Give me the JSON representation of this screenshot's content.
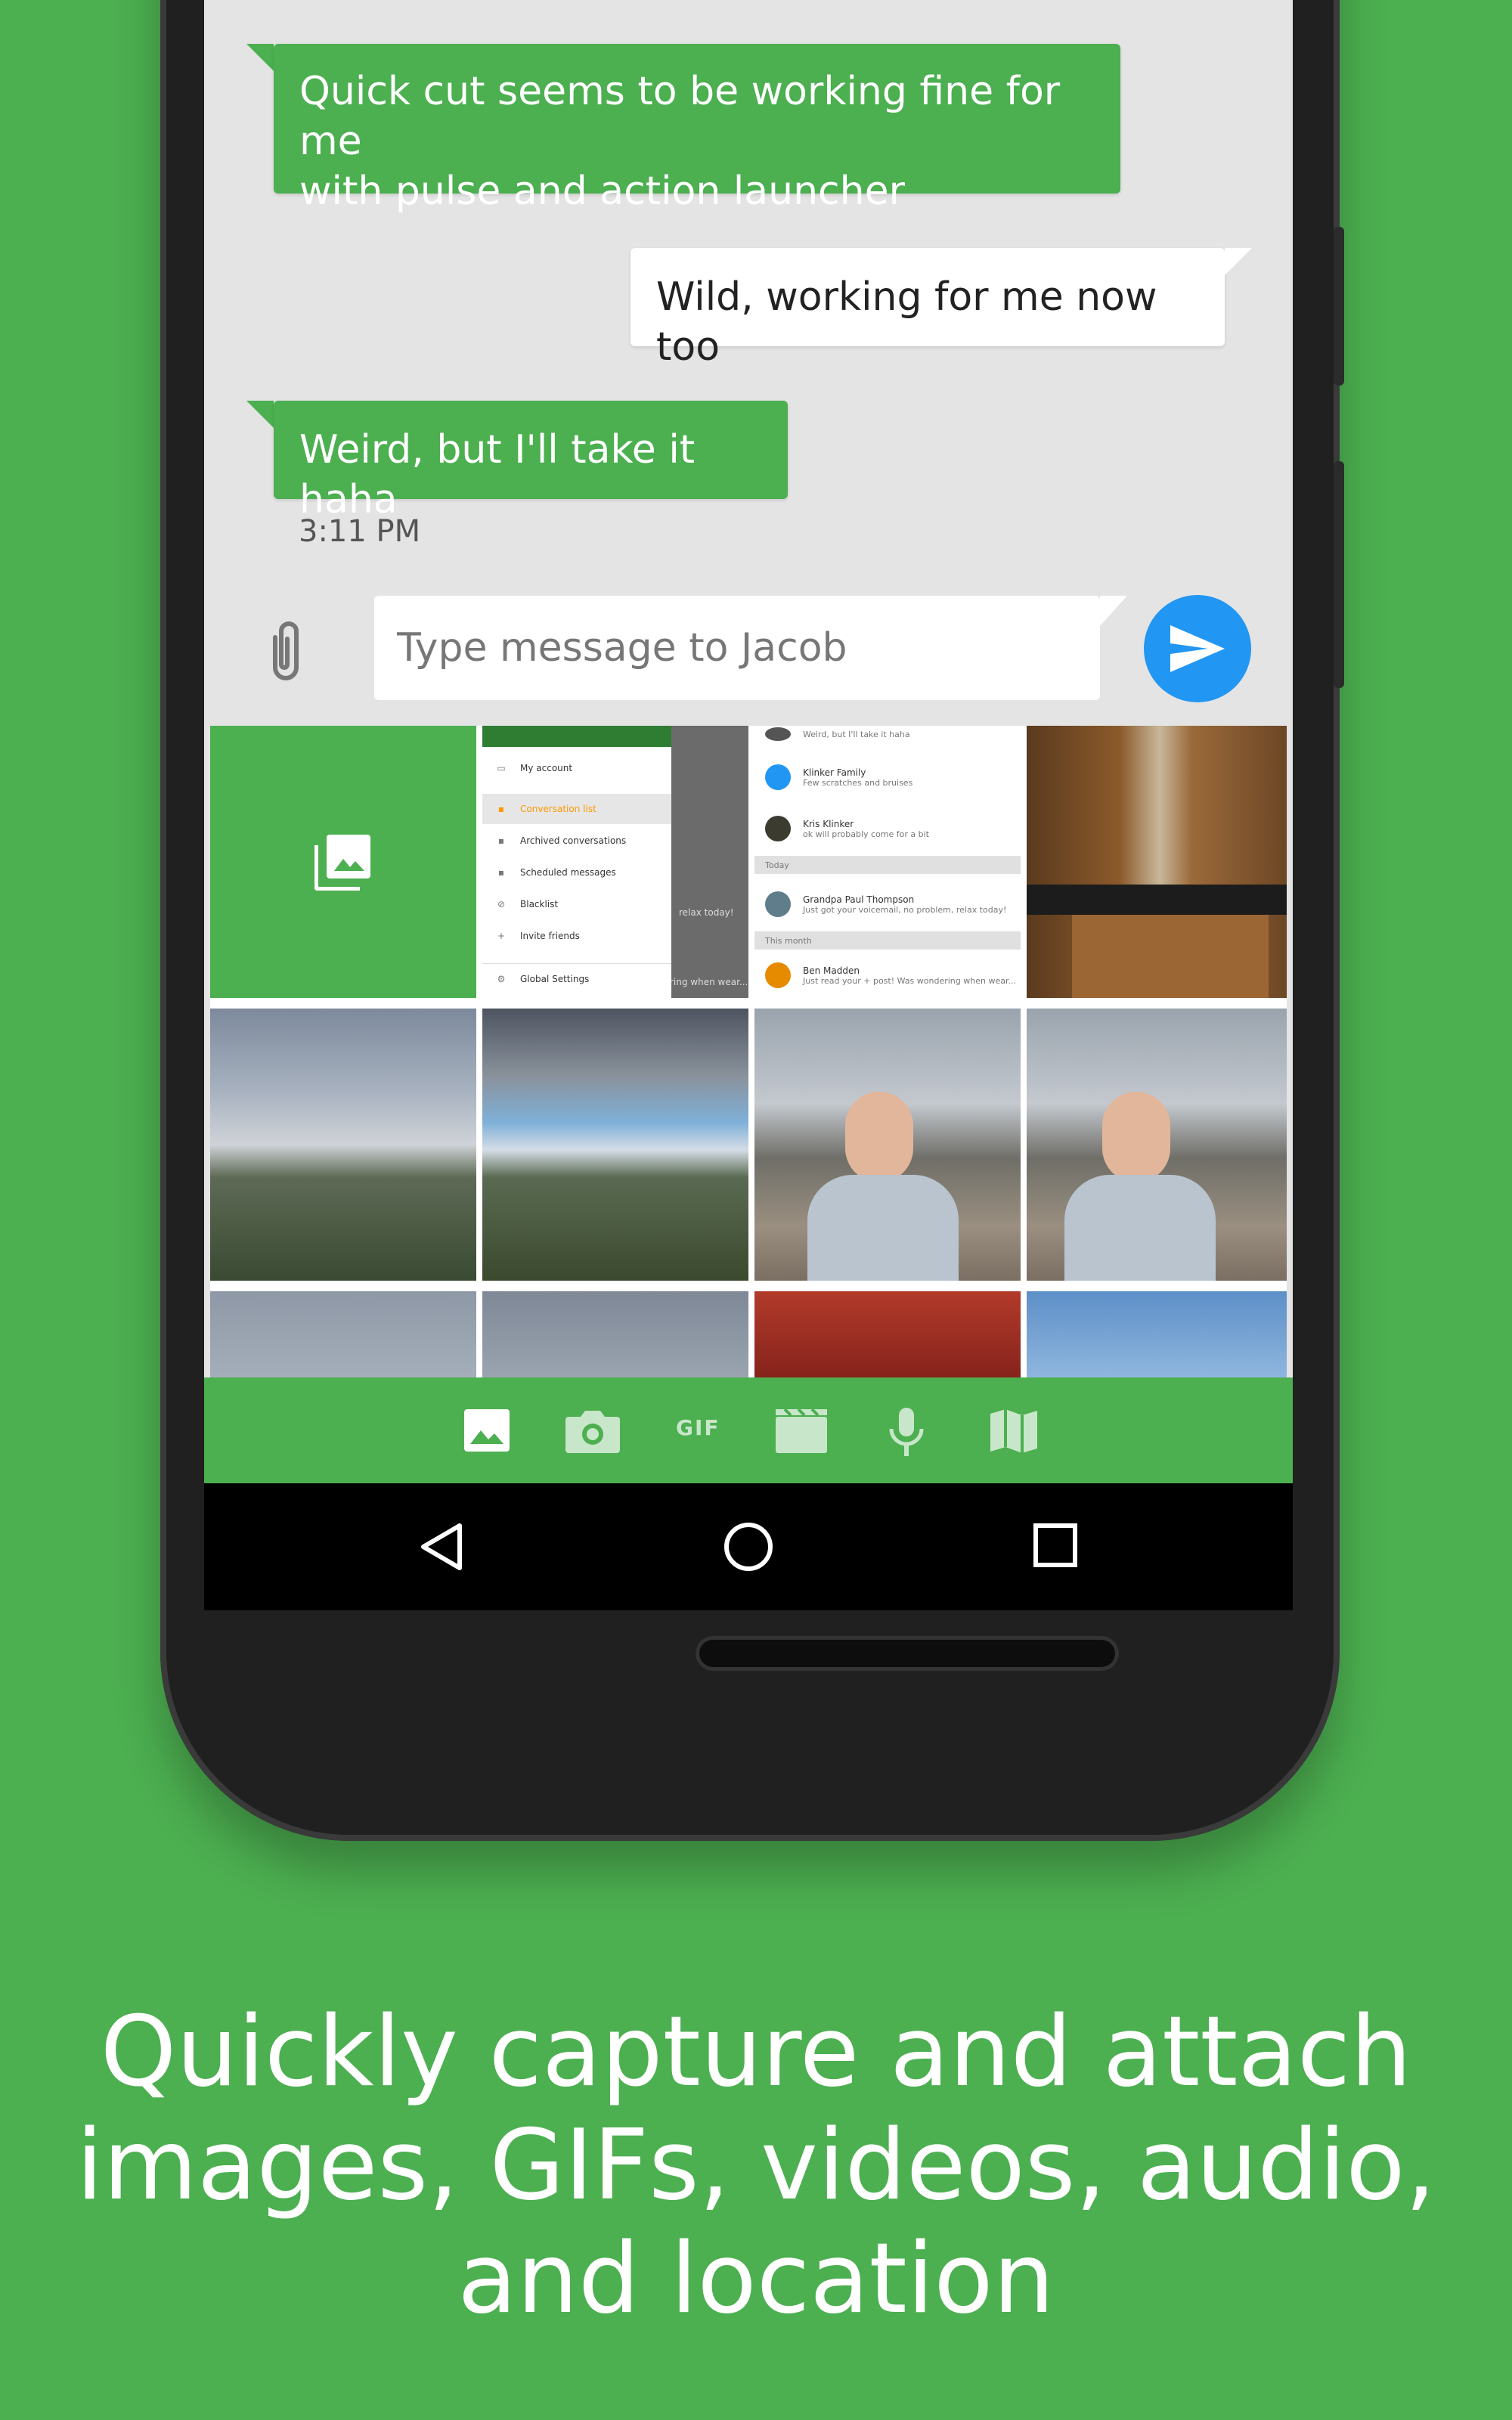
{
  "colors": {
    "background": "#4caf50",
    "incoming_bubble": "#4caf50",
    "outgoing_bubble": "#ffffff",
    "send_button": "#2196f3"
  },
  "conversation": {
    "messages": [
      {
        "direction": "incoming",
        "line1": "Quick cut seems to be working fine for me",
        "line2": "with pulse and action launcher"
      },
      {
        "direction": "outgoing",
        "text": "Wild, working for me now too"
      },
      {
        "direction": "incoming",
        "text": "Weird, but I'll take it haha"
      }
    ],
    "timestamp": "3:11 PM"
  },
  "composer": {
    "placeholder": "Type message to Jacob",
    "attach_icon": "paperclip-icon",
    "send_icon": "send-icon"
  },
  "gallery": {
    "open_gallery_icon": "photo-library-icon",
    "drawer_screenshot": {
      "items": [
        "My account",
        "Conversation list",
        "Archived conversations",
        "Scheduled messages",
        "Blacklist",
        "Invite friends",
        "Global Settings"
      ],
      "peek_line1": "relax today!",
      "peek_line2": "ring when wear..."
    },
    "conversation_screenshot": {
      "rows": [
        {
          "name": "",
          "snippet": "Weird, but I'll take it haha"
        },
        {
          "name": "Klinker Family",
          "snippet": "Few scratches and bruises"
        },
        {
          "name": "Kris Klinker",
          "snippet": "ok will probably come for a bit"
        },
        {
          "name": "Grandpa Paul Thompson",
          "snippet": "Just got your voicemail, no problem, relax today!"
        },
        {
          "name": "Ben Madden",
          "snippet": "Just read your + post! Was wondering when wear..."
        }
      ],
      "section_today": "Today",
      "section_month": "This month"
    }
  },
  "attach_bar": {
    "items": [
      {
        "name": "image",
        "icon": "image-icon"
      },
      {
        "name": "camera",
        "icon": "camera-icon"
      },
      {
        "name": "gif",
        "label": "GIF"
      },
      {
        "name": "video",
        "icon": "video-icon"
      },
      {
        "name": "audio",
        "icon": "microphone-icon"
      },
      {
        "name": "location",
        "icon": "map-icon"
      }
    ]
  },
  "nav_bar": {
    "back": "back-icon",
    "home": "home-icon",
    "recents": "recents-icon"
  },
  "caption": {
    "line1": "Quickly capture and attach",
    "line2": "images, GIFs, videos, audio,",
    "line3": "and location"
  }
}
